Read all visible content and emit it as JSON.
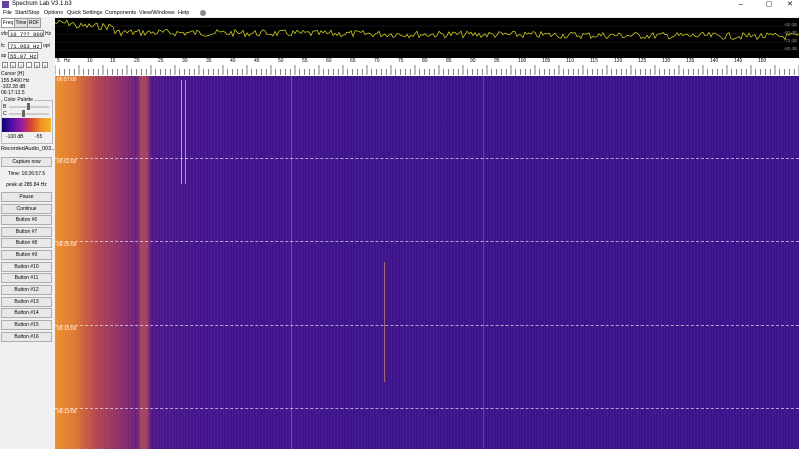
{
  "window": {
    "title": "Spectrum Lab V3.1.b3",
    "minimize": "–",
    "maximize": "▢",
    "close": "✕"
  },
  "menu": [
    "File",
    "Start/Stop",
    "Options",
    "Quick Settings",
    "Components",
    "View/Windows",
    "Help"
  ],
  "tabs": [
    "Freq",
    "Time",
    "RDF"
  ],
  "fields": {
    "vfo": {
      "label": "vfo",
      "value": "10 7?? 000",
      "unit": "Hz"
    },
    "fc": {
      "label": "fc",
      "value": "71.963 Hz",
      "unit": "opt"
    },
    "sp": {
      "label": "sp",
      "value": "55.97 Hz",
      "unit": ""
    }
  },
  "nav_buttons": [
    "<",
    "<",
    "+",
    "-",
    ">",
    ">"
  ],
  "cursor": {
    "heading": "Cursor [H]",
    "freq": "155.5490 Hz",
    "level": "-102.28 dB",
    "time": "06:17:12.5"
  },
  "color_palette": {
    "heading": "Color Palette",
    "b": "B",
    "c": "C",
    "scale_min": "-100 dB",
    "scale_max": "-55"
  },
  "file_label": "RecordedAudio_003...",
  "capture_button": "Capture now",
  "time_line": "Time: 16:26:57.5",
  "peak_line": "peak at 285.84 Hz",
  "buttons": [
    "Pause",
    "Continue",
    "Button #6",
    "Button #7",
    "Button #8",
    "Button #9",
    "Button #10",
    "Button #11",
    "Button #12",
    "Button #13",
    "Button #14",
    "Button #15",
    "Button #16"
  ],
  "spectrum": {
    "db_labels": [
      "-50 dB",
      "-60 dB",
      "-70 dB",
      "-80 dB"
    ]
  },
  "freq_axis": {
    "ticks": [
      "5",
      "10",
      "15",
      "20",
      "25",
      "30",
      "35",
      "40",
      "45",
      "50",
      "55",
      "60",
      "65",
      "70",
      "75",
      "80",
      "85",
      "90",
      "95",
      "100",
      "105",
      "110",
      "115",
      "120",
      "125",
      "130",
      "135",
      "140",
      "145",
      "150"
    ],
    "unit": "Hz"
  },
  "waterfall": {
    "timestamps": [
      "06:57:00",
      "06:52:00",
      "06:25:00",
      "06:15:00",
      "06:13:00"
    ]
  },
  "colors": {
    "waterfall_bg": "#3b138c",
    "spectrum_line": "#e0e020",
    "accent": "#6a3fa0"
  }
}
